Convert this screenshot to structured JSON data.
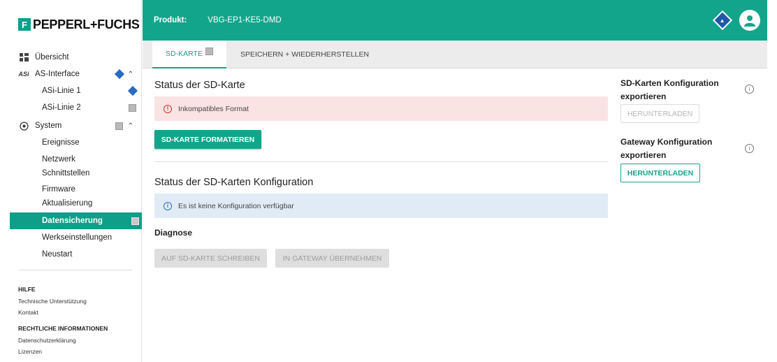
{
  "brand": {
    "mark": "F",
    "name": "PEPPERL+FUCHS"
  },
  "header": {
    "product_label": "Produkt:",
    "product_value": "VBG-EP1-KE5-DMD"
  },
  "sidebar": {
    "items": [
      {
        "label": "Übersicht"
      },
      {
        "label": "AS-Interface",
        "icon": "ASi"
      },
      {
        "label": "ASi-Linie 1"
      },
      {
        "label": "ASi-Linie 2"
      },
      {
        "label": "System"
      },
      {
        "label": "Ereignisse"
      },
      {
        "label": "Netzwerk",
        "label2": "Schnittstellen"
      },
      {
        "label": "Firmware",
        "label2": "Aktualisierung"
      },
      {
        "label": "Datensicherung"
      },
      {
        "label": "Werkseinstellungen"
      },
      {
        "label": "Neustart"
      }
    ],
    "help_heading": "HILFE",
    "help_links": [
      "Technische Unterstützung",
      "Kontakt"
    ],
    "legal_heading": "RECHTLICHE INFORMATIONEN",
    "legal_links": [
      "Datenschutzerklärung",
      "Lizenzen"
    ]
  },
  "tabs": [
    {
      "label": "SD-KARTE"
    },
    {
      "label": "SPEICHERN + WIEDERHERSTELLEN"
    }
  ],
  "main": {
    "sd_status_title": "Status der SD-Karte",
    "sd_status_alert": "Inkompatibles Format",
    "format_button": "SD-KARTE FORMATIEREN",
    "config_status_title": "Status der SD-Karten Konfiguration",
    "config_alert": "Es ist keine Konfiguration verfügbar",
    "diagnose_label": "Diagnose",
    "write_button": "AUF SD-KARTE SCHREIBEN",
    "apply_button": "IN GATEWAY ÜBERNEHMEN"
  },
  "right": {
    "sd_export_title_1": "SD-Karten Konfiguration",
    "sd_export_title_2": "exportieren",
    "sd_download": "HERUNTERLADEN",
    "gw_export_title_1": "Gateway Konfiguration",
    "gw_export_title_2": "exportieren",
    "gw_download": "HERUNTERLADEN"
  },
  "colors": {
    "accent": "#12a58b",
    "status_blue": "#2a6bc4",
    "error": "#c0392b"
  }
}
